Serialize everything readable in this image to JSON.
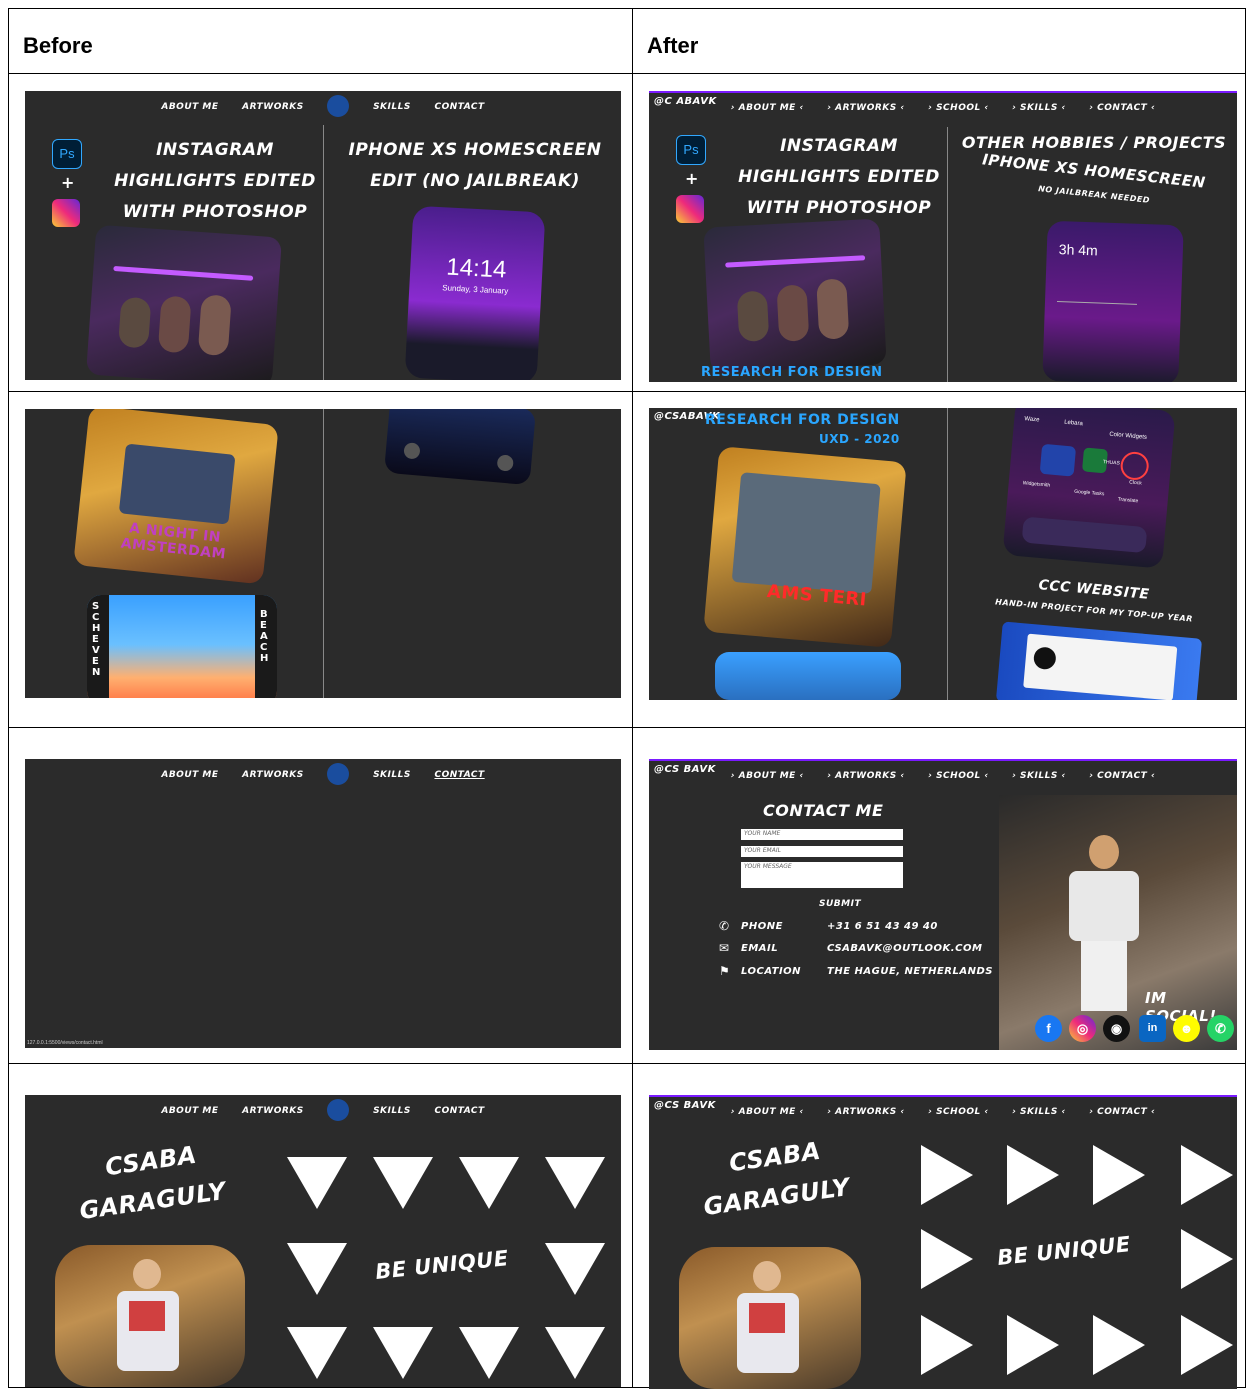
{
  "table": {
    "headers": {
      "before": "Before",
      "after": "After"
    }
  },
  "before_nav": {
    "about": "ABOUT ME",
    "artworks": "ARTWORKS",
    "skills": "SKILLS",
    "contact": "CONTACT"
  },
  "after_nav": {
    "items": [
      "› ABOUT ME ‹",
      "› ARTWORKS ‹",
      "› SCHOOL ‹",
      "› SKILLS ‹",
      "› CONTACT ‹"
    ]
  },
  "handles": {
    "r1": "@C ABAVK",
    "r2": "@CSABAVK",
    "r3": "@CS BAVK",
    "r4": "@CS BAVK"
  },
  "row1": {
    "before_left_title": "INSTAGRAM HIGHLIGHTS EDITED WITH PHOTOSHOP",
    "before_right_title": "IPHONE XS HOMESCREEN EDIT (NO JAILBREAK)",
    "before_time": "14:14",
    "before_date": "Sunday, 3 January",
    "plus": "+",
    "ps_label": "Ps",
    "research": "RESEARCH FOR DESIGN",
    "after_left_title": "INSTAGRAM HIGHLIGHTS EDITED WITH PHOTOSHOP",
    "after_right_title": "OTHER HOBBIES / PROJECTS",
    "after_right_sub": "IPHONE XS HOMESCREEN",
    "after_right_note": "NO JAILBREAK NEEDED",
    "screen_time": "3h 4m"
  },
  "row2": {
    "night_text": "A NIGHT IN AMSTERDAM",
    "schev_left": "SCHEVEN",
    "schev_right": "BEACH",
    "research": "RESEARCH FOR DESIGN",
    "uxd": "UXD - 2020",
    "amst": "AMS TERI",
    "ccc_title": "CCC WEBSITE",
    "ccc_sub": "HAND-IN PROJECT FOR MY TOP-UP YEAR",
    "apps": [
      "Waze",
      "Lebara",
      "Color Widgets",
      "Widgetsmith",
      "Google Tasks",
      "Translate",
      "THUAS",
      "Clock"
    ]
  },
  "row3": {
    "url": "127.0.0.1:5500/views/contact.html",
    "contact_title": "CONTACT ME",
    "name_ph": "YOUR NAME",
    "email_ph": "YOUR EMAIL",
    "msg_ph": "YOUR MESSAGE",
    "submit": "SUBMIT",
    "phone_label": "PHONE",
    "phone_value": "+31 6 51 43 49 40",
    "email_label": "EMAIL",
    "email_value": "CSABAVK@OUTLOOK.COM",
    "location_label": "LOCATION",
    "location_value": "THE HAGUE, NETHERLANDS",
    "social": "IM SOCIAL!"
  },
  "row4": {
    "name1": "CSABA",
    "name2": "GARAGULY",
    "slogan": "BE UNIQUE"
  },
  "colors": {
    "bg": "#2b2b2b",
    "neon_pink": "#e83aff",
    "neon_blue": "#2aa6ff",
    "red": "#ff2a2a"
  }
}
